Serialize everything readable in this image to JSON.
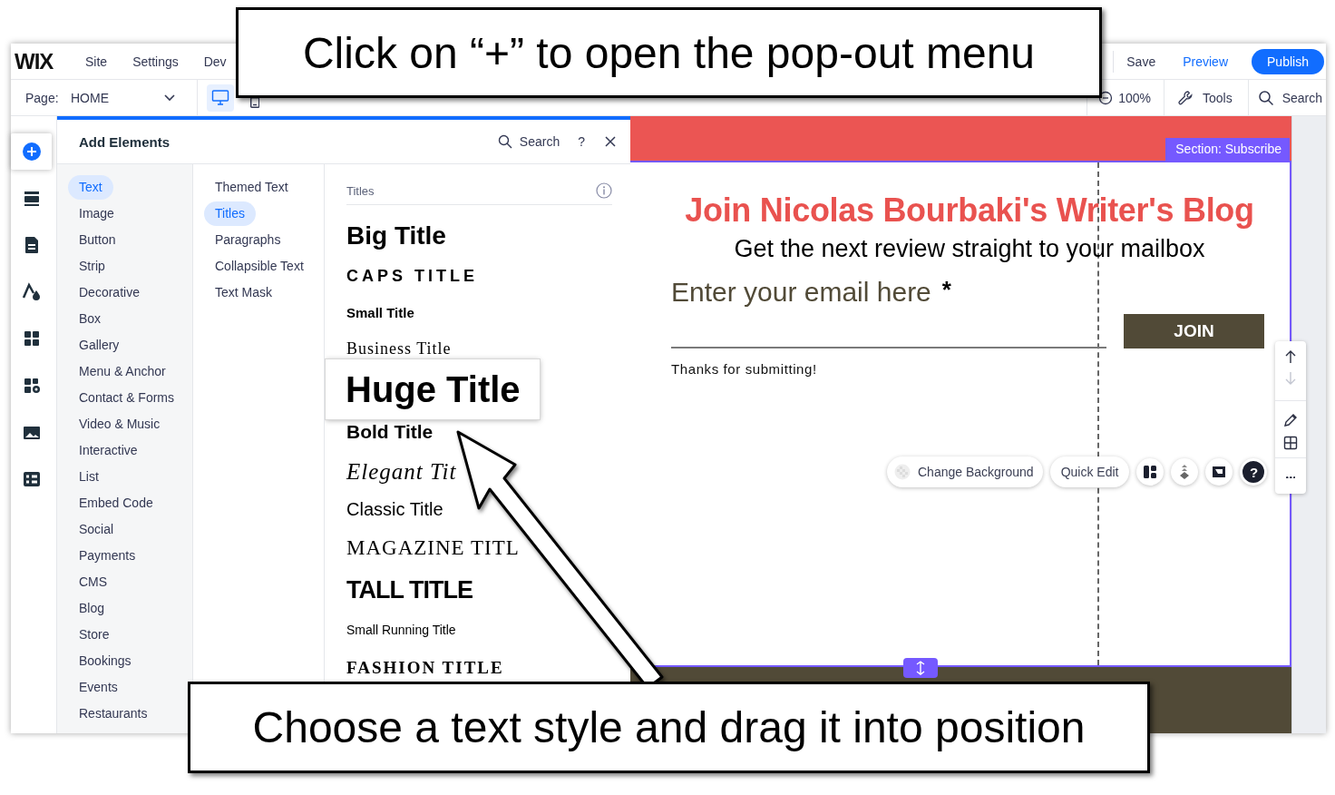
{
  "top_bar": {
    "logo": "WIX",
    "menu": [
      "Site",
      "Settings",
      "Dev"
    ],
    "save": "Save",
    "preview": "Preview",
    "publish": "Publish"
  },
  "page_bar": {
    "page_label": "Page:",
    "page": "HOME",
    "devices": [
      {
        "kind": "desktop",
        "selected": true
      },
      {
        "kind": "mobile",
        "selected": false
      }
    ],
    "zoom": "100%",
    "tools": "Tools",
    "search": "Search"
  },
  "rail": [
    {
      "kind": "add",
      "selected": true
    },
    {
      "kind": "sections",
      "selected": false
    },
    {
      "kind": "pages",
      "selected": false
    },
    {
      "kind": "design",
      "selected": false
    },
    {
      "kind": "apps",
      "selected": false
    },
    {
      "kind": "business",
      "selected": false
    },
    {
      "kind": "media",
      "selected": false
    },
    {
      "kind": "cms",
      "selected": false
    }
  ],
  "panel": {
    "title": "Add Elements",
    "search": "Search",
    "help": "?",
    "categories": [
      {
        "label": "Text",
        "selected": true
      },
      {
        "label": "Image",
        "selected": false
      },
      {
        "label": "Button",
        "selected": false
      },
      {
        "label": "Strip",
        "selected": false
      },
      {
        "label": "Decorative",
        "selected": false
      },
      {
        "label": "Box",
        "selected": false
      },
      {
        "label": "Gallery",
        "selected": false
      },
      {
        "label": "Menu & Anchor",
        "selected": false
      },
      {
        "label": "Contact & Forms",
        "selected": false
      },
      {
        "label": "Video & Music",
        "selected": false
      },
      {
        "label": "Interactive",
        "selected": false
      },
      {
        "label": "List",
        "selected": false
      },
      {
        "label": "Embed Code",
        "selected": false
      },
      {
        "label": "Social",
        "selected": false
      },
      {
        "label": "Payments",
        "selected": false
      },
      {
        "label": "CMS",
        "selected": false
      },
      {
        "label": "Blog",
        "selected": false
      },
      {
        "label": "Store",
        "selected": false
      },
      {
        "label": "Bookings",
        "selected": false
      },
      {
        "label": "Events",
        "selected": false
      },
      {
        "label": "Restaurants",
        "selected": false
      }
    ],
    "subcategories": [
      {
        "label": "Themed Text",
        "selected": false
      },
      {
        "label": "Titles",
        "selected": true
      },
      {
        "label": "Paragraphs",
        "selected": false
      },
      {
        "label": "Collapsible Text",
        "selected": false
      },
      {
        "label": "Text Mask",
        "selected": false
      }
    ],
    "group_title": "Titles",
    "titles": [
      {
        "label": "Big Title",
        "kind": "big",
        "highlighted": false
      },
      {
        "label": "CAPS TITLE",
        "kind": "caps",
        "highlighted": false
      },
      {
        "label": "Small Title",
        "kind": "small",
        "highlighted": false
      },
      {
        "label": "Business Title",
        "kind": "business",
        "highlighted": false
      },
      {
        "label": "Huge Title",
        "kind": "huge",
        "highlighted": true
      },
      {
        "label": "Bold Title",
        "kind": "bold",
        "highlighted": false
      },
      {
        "label": "Elegant Tit",
        "kind": "elegant",
        "highlighted": false
      },
      {
        "label": "Classic Title",
        "kind": "classic",
        "highlighted": false
      },
      {
        "label": "MAGAZINE TITL",
        "kind": "magazine",
        "highlighted": false
      },
      {
        "label": "TALL TITLE",
        "kind": "tall",
        "highlighted": false
      },
      {
        "label": "Small Running Title",
        "kind": "running",
        "highlighted": false
      },
      {
        "label": "FASHION TITLE",
        "kind": "fashion",
        "highlighted": false
      }
    ]
  },
  "canvas": {
    "section_label": "Section: Subscribe",
    "heading": "Join Nicolas Bourbaki's Writer's Blog",
    "subheading": "Get the next review straight to your mailbox",
    "field": {
      "label": "Enter your email here",
      "required_mark": "*"
    },
    "button": "JOIN",
    "message": "Thanks for submitting!",
    "toolbar": {
      "change_background": "Change Background",
      "quick_edit": "Quick Edit",
      "help": "?"
    },
    "side_toolbar": [
      {
        "kind": "up",
        "disabled": false
      },
      {
        "kind": "down",
        "disabled": true
      },
      {
        "kind": "edit",
        "disabled": false
      },
      {
        "kind": "layout",
        "disabled": false
      },
      {
        "kind": "more",
        "disabled": false
      }
    ]
  },
  "callouts": [
    {
      "kind": "top",
      "text": "Click on “+” to open the pop-out menu"
    },
    {
      "kind": "bottom",
      "text": "Choose a text style and drag it into position"
    }
  ]
}
